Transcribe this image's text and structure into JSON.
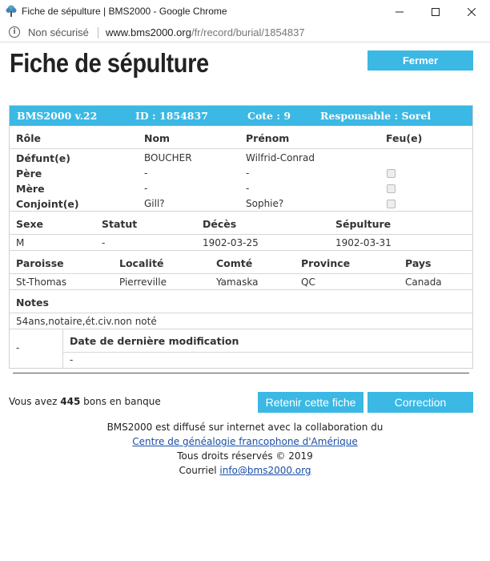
{
  "window": {
    "title": "Fiche de sépulture | BMS2000 - Google Chrome",
    "min_glyph": "—",
    "max_glyph": "☐",
    "close_glyph": "✕"
  },
  "address": {
    "security": "Non sécurisé",
    "host": "www.bms2000.org",
    "path": "/fr/record/burial/1854837"
  },
  "page": {
    "title": "Fiche de sépulture",
    "close_label": "Fermer"
  },
  "record": {
    "header": {
      "version": "BMS2000 v.22",
      "id": "ID : 1854837",
      "cote": "Cote : 9",
      "responsable": "Responsable : Sorel"
    },
    "persons": {
      "columns": [
        "Rôle",
        "Nom",
        "Prénom",
        "Feu(e)"
      ],
      "rows": [
        {
          "role": "Défunt(e)",
          "nom": "BOUCHER",
          "prenom": "Wilfrid-Conrad",
          "feu": null
        },
        {
          "role": "Père",
          "nom": "-",
          "prenom": "-",
          "feu": false
        },
        {
          "role": "Mère",
          "nom": "-",
          "prenom": "-",
          "feu": false
        },
        {
          "role": "Conjoint(e)",
          "nom": "Gill?",
          "prenom": "Sophie?",
          "feu": false
        }
      ]
    },
    "vitals": {
      "columns": [
        "Sexe",
        "Statut",
        "Décès",
        "Sépulture"
      ],
      "values": [
        "M",
        "-",
        "1902-03-25",
        "1902-03-31"
      ]
    },
    "place": {
      "columns": [
        "Paroisse",
        "Localité",
        "Comté",
        "Province",
        "Pays"
      ],
      "values": [
        "St-Thomas",
        "Pierreville",
        "Yamaska",
        "QC",
        "Canada"
      ]
    },
    "notes": {
      "label": "Notes",
      "value": "54ans,notaire,ét.civ.non noté"
    },
    "modification": {
      "left_value": "-",
      "label": "Date de dernière modification",
      "value": "-"
    }
  },
  "bank": {
    "prefix": "Vous avez ",
    "count": "445",
    "suffix": " bons en banque"
  },
  "actions": {
    "retain_label": "Retenir cette fiche",
    "correction_label": "Correction"
  },
  "footer": {
    "line1": "BMS2000 est diffusé sur internet avec la collaboration du",
    "link1": "Centre de généalogie francophone d'Amérique",
    "line3": "Tous droits réservés © 2019",
    "line4_prefix": "Courriel ",
    "email": "info@bms2000.org"
  },
  "colors": {
    "accent": "#3bb8e4",
    "link": "#1a4ea8"
  }
}
